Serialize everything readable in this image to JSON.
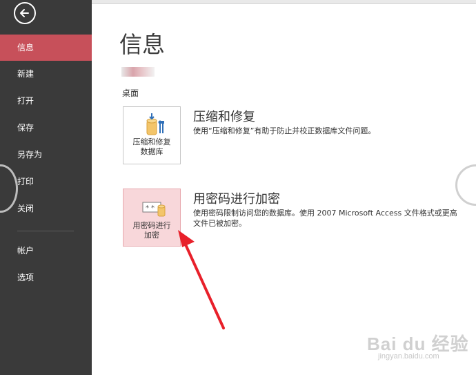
{
  "sidebar": {
    "items": [
      {
        "label": "信息",
        "active": true
      },
      {
        "label": "新建"
      },
      {
        "label": "打开"
      },
      {
        "label": "保存"
      },
      {
        "label": "另存为"
      },
      {
        "label": "打印"
      },
      {
        "label": "关闭"
      },
      {
        "label": "帐户"
      },
      {
        "label": "选项"
      }
    ]
  },
  "main": {
    "title": "信息",
    "location": "桌面",
    "compact": {
      "tile_label_line1": "压缩和修复",
      "tile_label_line2": "数据库",
      "heading": "压缩和修复",
      "description": "使用“压缩和修复”有助于防止并校正数据库文件问题。"
    },
    "encrypt": {
      "tile_label_line1": "用密码进行",
      "tile_label_line2": "加密",
      "heading": "用密码进行加密",
      "description_line1": "使用密码限制访问您的数据库。使用 2007 Microsoft Access 文件格式或更高",
      "description_line2": "文件已被加密。"
    }
  },
  "watermark": {
    "logo": "Bai du 经验",
    "url": "jingyan.baidu.com"
  },
  "colors": {
    "sidebar_bg": "#3a3a3a",
    "active_item": "#c7505a",
    "highlight_tile": "#f8d7da",
    "annotation_arrow": "#e8202a"
  }
}
